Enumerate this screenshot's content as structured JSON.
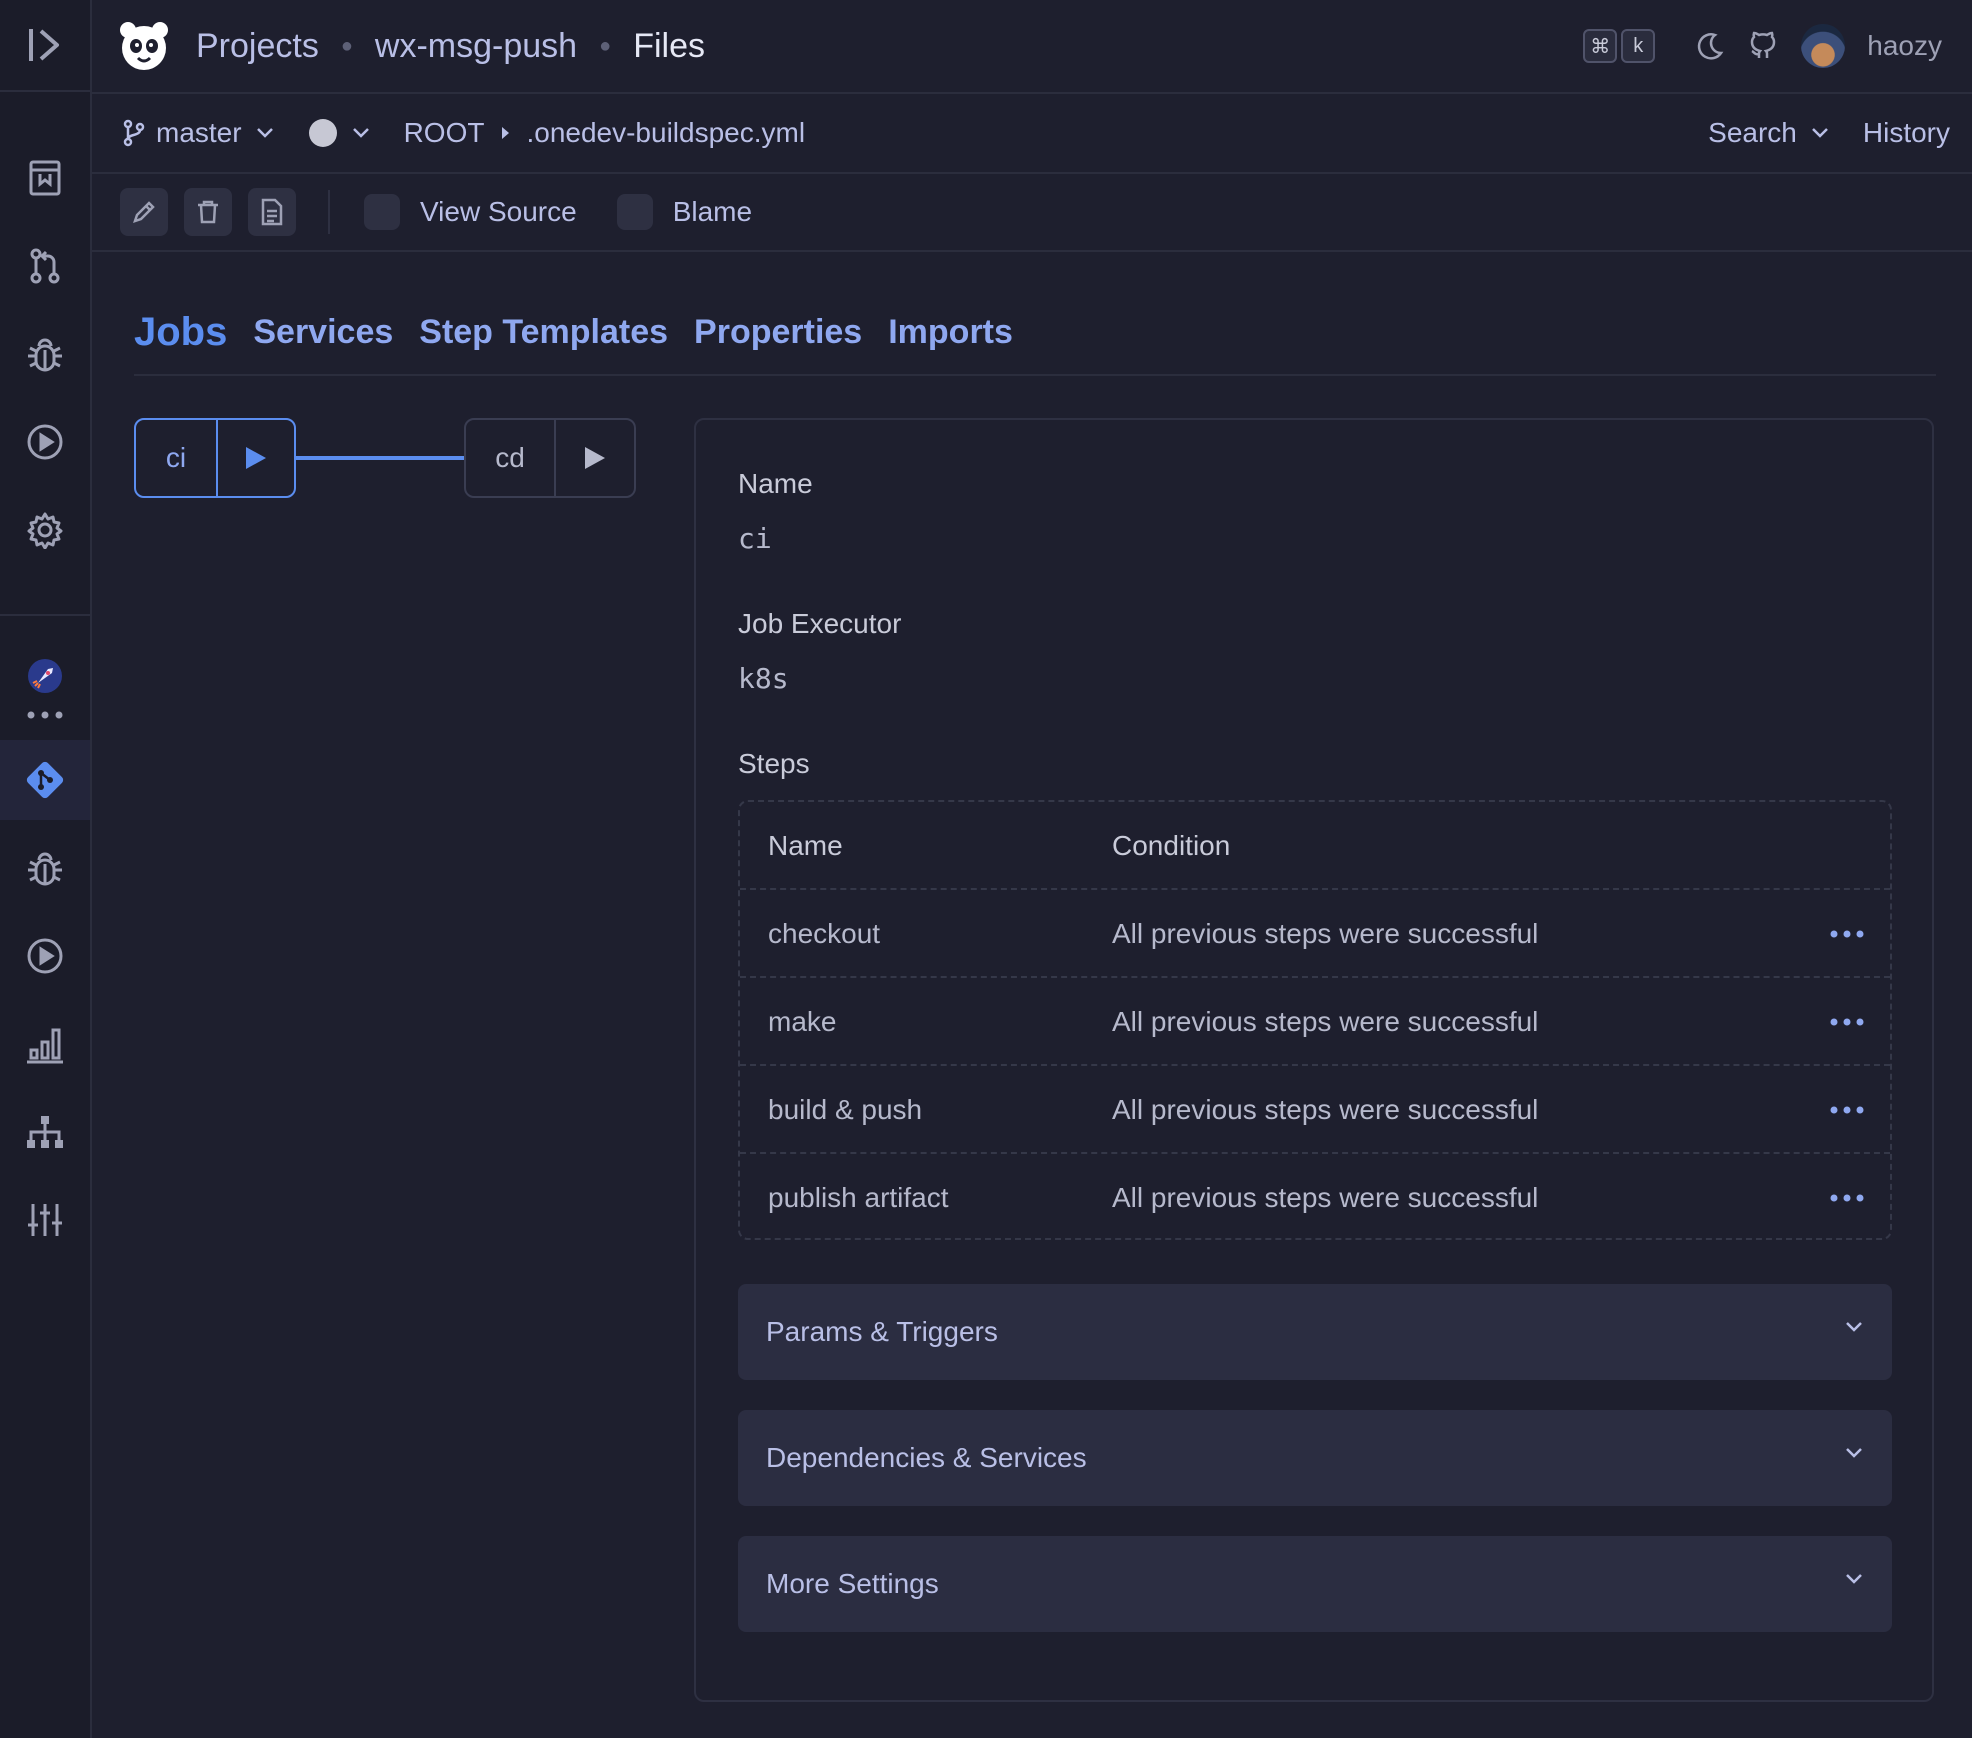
{
  "header": {
    "breadcrumbs": [
      "Projects",
      "wx-msg-push",
      "Files"
    ],
    "shortcut_keys": [
      "⌘",
      "k"
    ],
    "username": "haozy"
  },
  "file_nav": {
    "branch": "master",
    "path": [
      "ROOT",
      ".onedev-buildspec.yml"
    ],
    "search_label": "Search",
    "history_label": "History"
  },
  "toolbar": {
    "view_source_label": "View Source",
    "blame_label": "Blame"
  },
  "tabs": [
    "Jobs",
    "Services",
    "Step Templates",
    "Properties",
    "Imports"
  ],
  "active_tab": "Jobs",
  "jobs": [
    "ci",
    "cd"
  ],
  "selected_job": "ci",
  "job_detail": {
    "name_label": "Name",
    "name_value": "ci",
    "executor_label": "Job Executor",
    "executor_value": "k8s",
    "steps_label": "Steps",
    "steps_columns": [
      "Name",
      "Condition"
    ],
    "steps": [
      {
        "name": "checkout",
        "condition": "All previous steps were successful"
      },
      {
        "name": "make",
        "condition": "All previous steps were successful"
      },
      {
        "name": "build & push",
        "condition": "All previous steps were successful"
      },
      {
        "name": "publish artifact",
        "condition": "All previous steps were successful"
      }
    ],
    "sections": [
      "Params & Triggers",
      "Dependencies & Services",
      "More Settings"
    ]
  },
  "colors": {
    "background": "#1e1f2e",
    "accent": "#5b8def",
    "link": "#8fa8f0"
  }
}
